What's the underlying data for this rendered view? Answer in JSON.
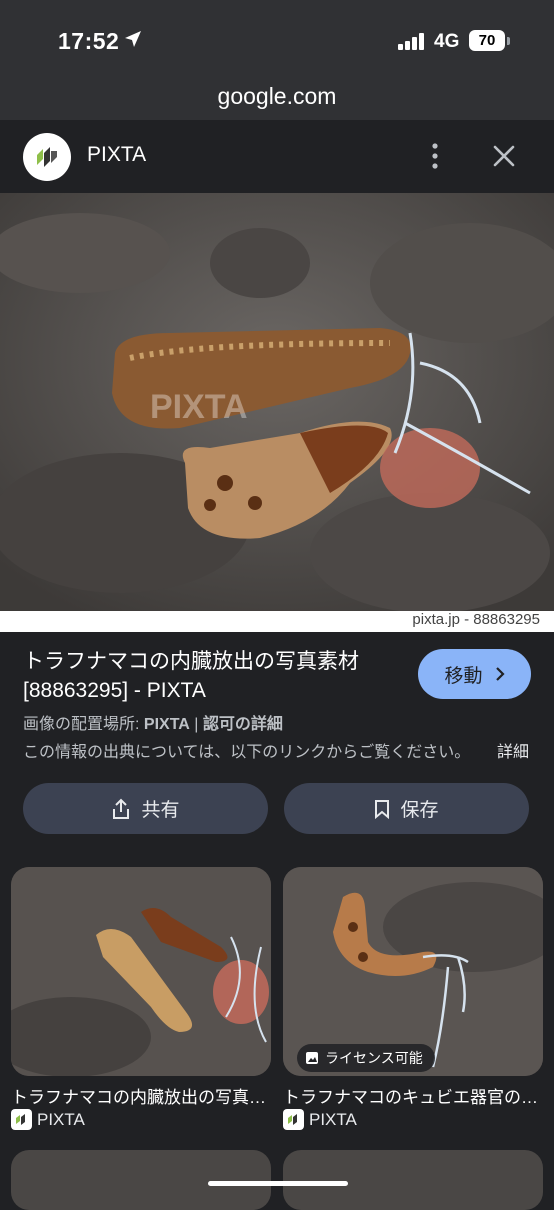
{
  "status_bar": {
    "time": "17:52",
    "network": "4G",
    "battery": "70"
  },
  "browser": {
    "url": "google.com"
  },
  "header": {
    "site_name": "PIXTA"
  },
  "image": {
    "credit": "pixta.jp - 88863295",
    "watermark": "PIXTA"
  },
  "result": {
    "title": "トラフナマコの内臓放出の写真素材 [88863295] - PIXTA",
    "visit_label": "移動",
    "meta_prefix": "画像の配置場所: ",
    "meta_site": "PIXTA",
    "meta_sep": " | ",
    "meta_license": "認可の詳細",
    "source_text": "この情報の出典については、以下のリンクからご覧ください。",
    "source_link": "詳細"
  },
  "actions": {
    "share_label": "共有",
    "save_label": "保存"
  },
  "related": [
    {
      "title": "トラフナマコの内臓放出の写真…",
      "site": "PIXTA",
      "badge": ""
    },
    {
      "title": "トラフナマコのキュビエ器官の…",
      "site": "PIXTA",
      "badge": "ライセンス可能"
    }
  ],
  "colors": {
    "background": "#202124",
    "accent": "#8ab4f8",
    "button": "#3c4252"
  }
}
